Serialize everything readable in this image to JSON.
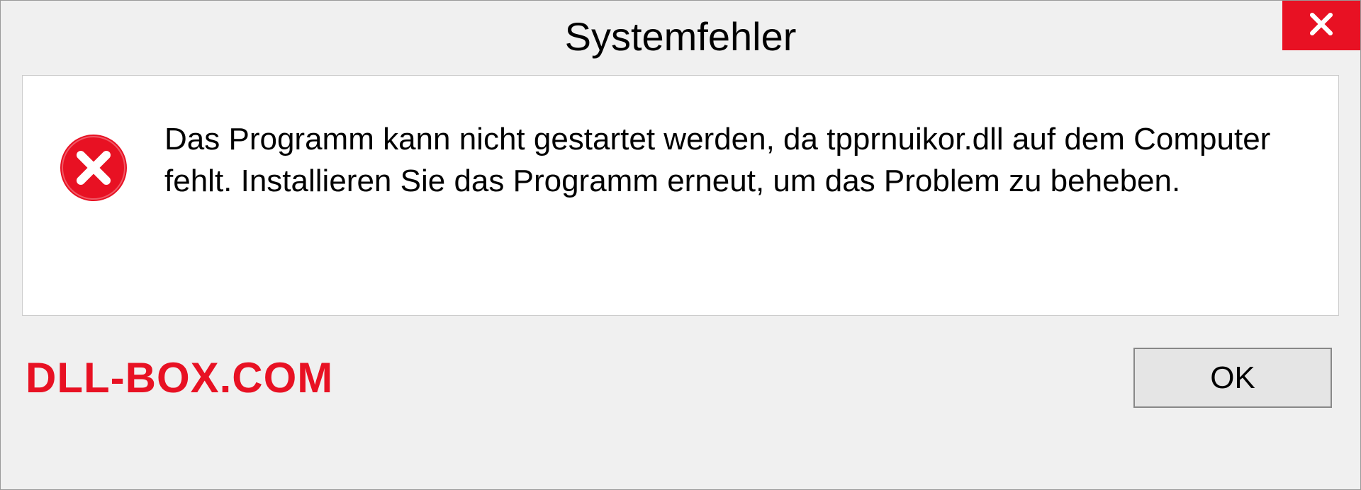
{
  "dialog": {
    "title": "Systemfehler",
    "message": "Das Programm kann nicht gestartet werden, da tpprnuikor.dll auf dem Computer fehlt. Installieren Sie das Programm erneut, um das Problem zu beheben.",
    "ok_label": "OK"
  },
  "watermark": "DLL-BOX.COM",
  "colors": {
    "accent_red": "#e81123"
  }
}
